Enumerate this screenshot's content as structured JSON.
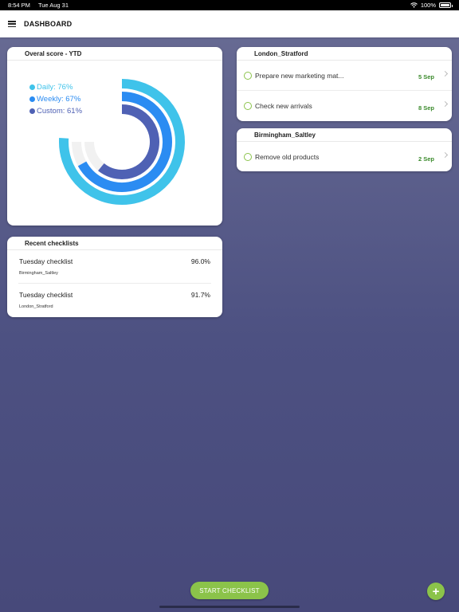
{
  "status_bar": {
    "time": "8:54 PM",
    "date": "Tue Aug 31",
    "battery": "100%",
    "battery_level": 1.0
  },
  "app_bar": {
    "title": "DASHBOARD",
    "menu_icon": "hamburger-menu-icon"
  },
  "score_card": {
    "title": "Overal score - YTD",
    "legend": [
      {
        "label": "Daily: 76%",
        "color": "#3fc3ea"
      },
      {
        "label": "Weekly: 67%",
        "color": "#2b8cf2"
      },
      {
        "label": "Custom: 61%",
        "color": "#4f61b4"
      }
    ],
    "chart_data": {
      "type": "radial-bar",
      "series": [
        {
          "name": "Daily",
          "value": 76,
          "color": "#3fc3ea"
        },
        {
          "name": "Weekly",
          "value": 67,
          "color": "#2b8cf2"
        },
        {
          "name": "Custom",
          "value": 61,
          "color": "#4f61b4"
        }
      ],
      "max": 100,
      "track_color": "#f1f1f1"
    }
  },
  "locations": [
    {
      "name": "London_Stratford",
      "tasks": [
        {
          "label": "Prepare new marketing mat...",
          "date": "5 Sep"
        },
        {
          "label": "Check new arrivals",
          "date": "8 Sep"
        }
      ]
    },
    {
      "name": "Birmingham_Saltley",
      "tasks": [
        {
          "label": "Remove old products",
          "date": "2 Sep"
        }
      ]
    }
  ],
  "recent": {
    "title": "Recent checklists",
    "rows": [
      {
        "name": "Tuesday checklist",
        "site": "Birmingham_Saltley",
        "score": "96.0%"
      },
      {
        "name": "Tuesday checklist",
        "site": "London_Stratford",
        "score": "91.7%"
      }
    ]
  },
  "actions": {
    "start_label": "START CHECKLIST",
    "add_label": "+"
  },
  "colors": {
    "accent": "#8bc34a",
    "date_green": "#3a8a2b"
  }
}
